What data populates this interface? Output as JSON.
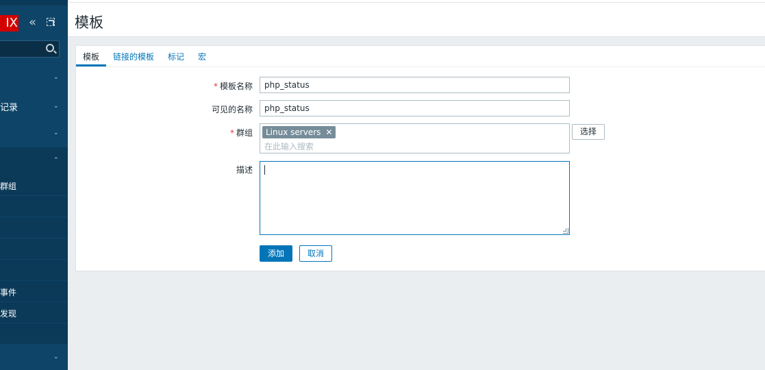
{
  "sidebar": {
    "logo": "IX",
    "items": [
      {
        "label": "",
        "chevron": "⌄"
      },
      {
        "label": "记录",
        "chevron": "⌄"
      },
      {
        "label": "",
        "chevron": "⌄"
      },
      {
        "label": "",
        "chevron": "⌃"
      },
      {
        "label": "",
        "chevron": "⌄"
      }
    ],
    "sub_items": [
      {
        "label": "群组"
      },
      {
        "label": ""
      },
      {
        "label": ""
      },
      {
        "label": ""
      },
      {
        "label": ""
      },
      {
        "label": "事件"
      },
      {
        "label": "发现"
      },
      {
        "label": ""
      }
    ]
  },
  "header": {
    "title": "模板"
  },
  "tabs": [
    {
      "label": "模板",
      "active": true
    },
    {
      "label": "链接的模板",
      "active": false
    },
    {
      "label": "标记",
      "active": false
    },
    {
      "label": "宏",
      "active": false
    }
  ],
  "form": {
    "template_name": {
      "label": "模板名称",
      "required": true,
      "value": "php_status"
    },
    "visible_name": {
      "label": "可见的名称",
      "required": false,
      "value": "php_status"
    },
    "groups": {
      "label": "群组",
      "required": true,
      "selected": [
        "Linux servers"
      ],
      "placeholder": "在此输入搜索",
      "select_label": "选择"
    },
    "description": {
      "label": "描述",
      "value": ""
    },
    "add_label": "添加",
    "cancel_label": "取消"
  },
  "colors": {
    "sidebar": "#0e4467",
    "accent": "#0275b8",
    "required": "#e33734",
    "chip": "#768d99"
  }
}
